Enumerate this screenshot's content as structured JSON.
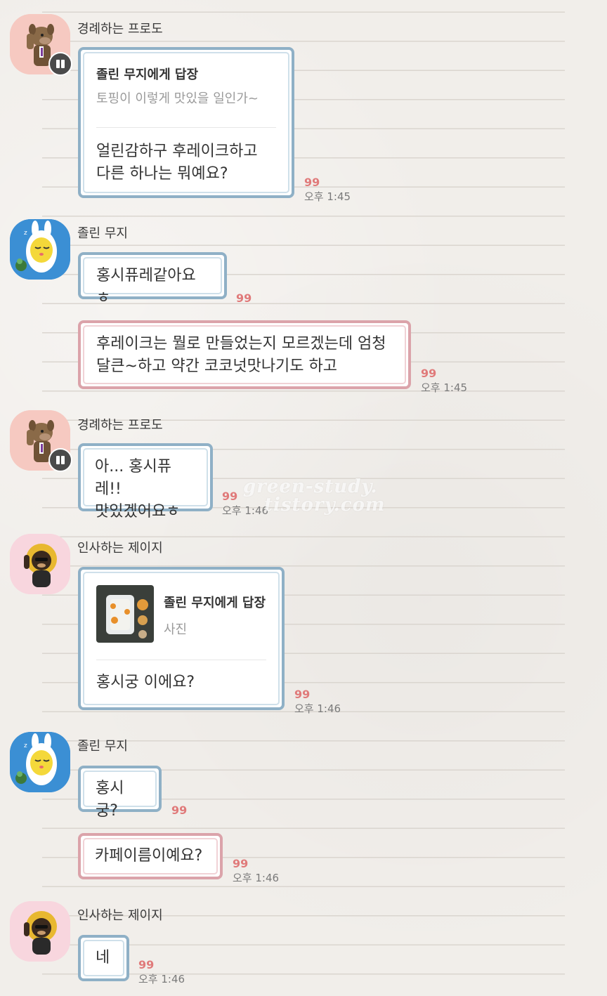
{
  "messages": {
    "g1": {
      "name": "경례하는 프로도",
      "reply_title": "졸린 무지에게 답장",
      "reply_quote": "토핑이 이렇게 맛있을 일인가~",
      "line1": "얼린감하구 후레이크하고",
      "line2": "다른 하나는 뭐예요?",
      "count": "99",
      "time": "오후 1:45"
    },
    "g2": {
      "name": "졸린 무지",
      "m1": "홍시퓨레같아요ㅎ",
      "m1_count": "99",
      "m2_line1": "후레이크는 뭘로 만들었는지 모르겠는데 엄청",
      "m2_line2": "달큰~하고 약간 코코넛맛나기도 하고",
      "m2_count": "99",
      "time": "오후 1:45"
    },
    "g3": {
      "name": "경례하는 프로도",
      "line1": "아... 홍시퓨레!!",
      "line2": "맛있겠어요ㅎ",
      "count": "99",
      "time": "오후 1:46"
    },
    "g4": {
      "name": "인사하는 제이지",
      "reply_title": "졸린 무지에게 답장",
      "reply_quote": "사진",
      "text": "홍시궁 이에요?",
      "count": "99",
      "time": "오후 1:46"
    },
    "g5": {
      "name": "졸린 무지",
      "m1": "홍시궁?",
      "m1_count": "99",
      "m2": "카페이름이예요?",
      "m2_count": "99",
      "time": "오후 1:46"
    },
    "g6": {
      "name": "인사하는 제이지",
      "text": "네",
      "count": "99",
      "time": "오후 1:46"
    }
  },
  "watermark": {
    "line1": "green-study.",
    "line2": "tistory.com"
  },
  "colors": {
    "read_count": "#e07a7a",
    "bubble_blue_border": "#8fb0c6",
    "bubble_pink_border": "#dba3aa",
    "paper": "#f1eeea"
  },
  "icons": {
    "frodo_avatar": "frodo-character",
    "muzi_avatar": "muzi-character",
    "jayg_avatar": "jayg-character",
    "pause_badge": "pause-icon"
  }
}
